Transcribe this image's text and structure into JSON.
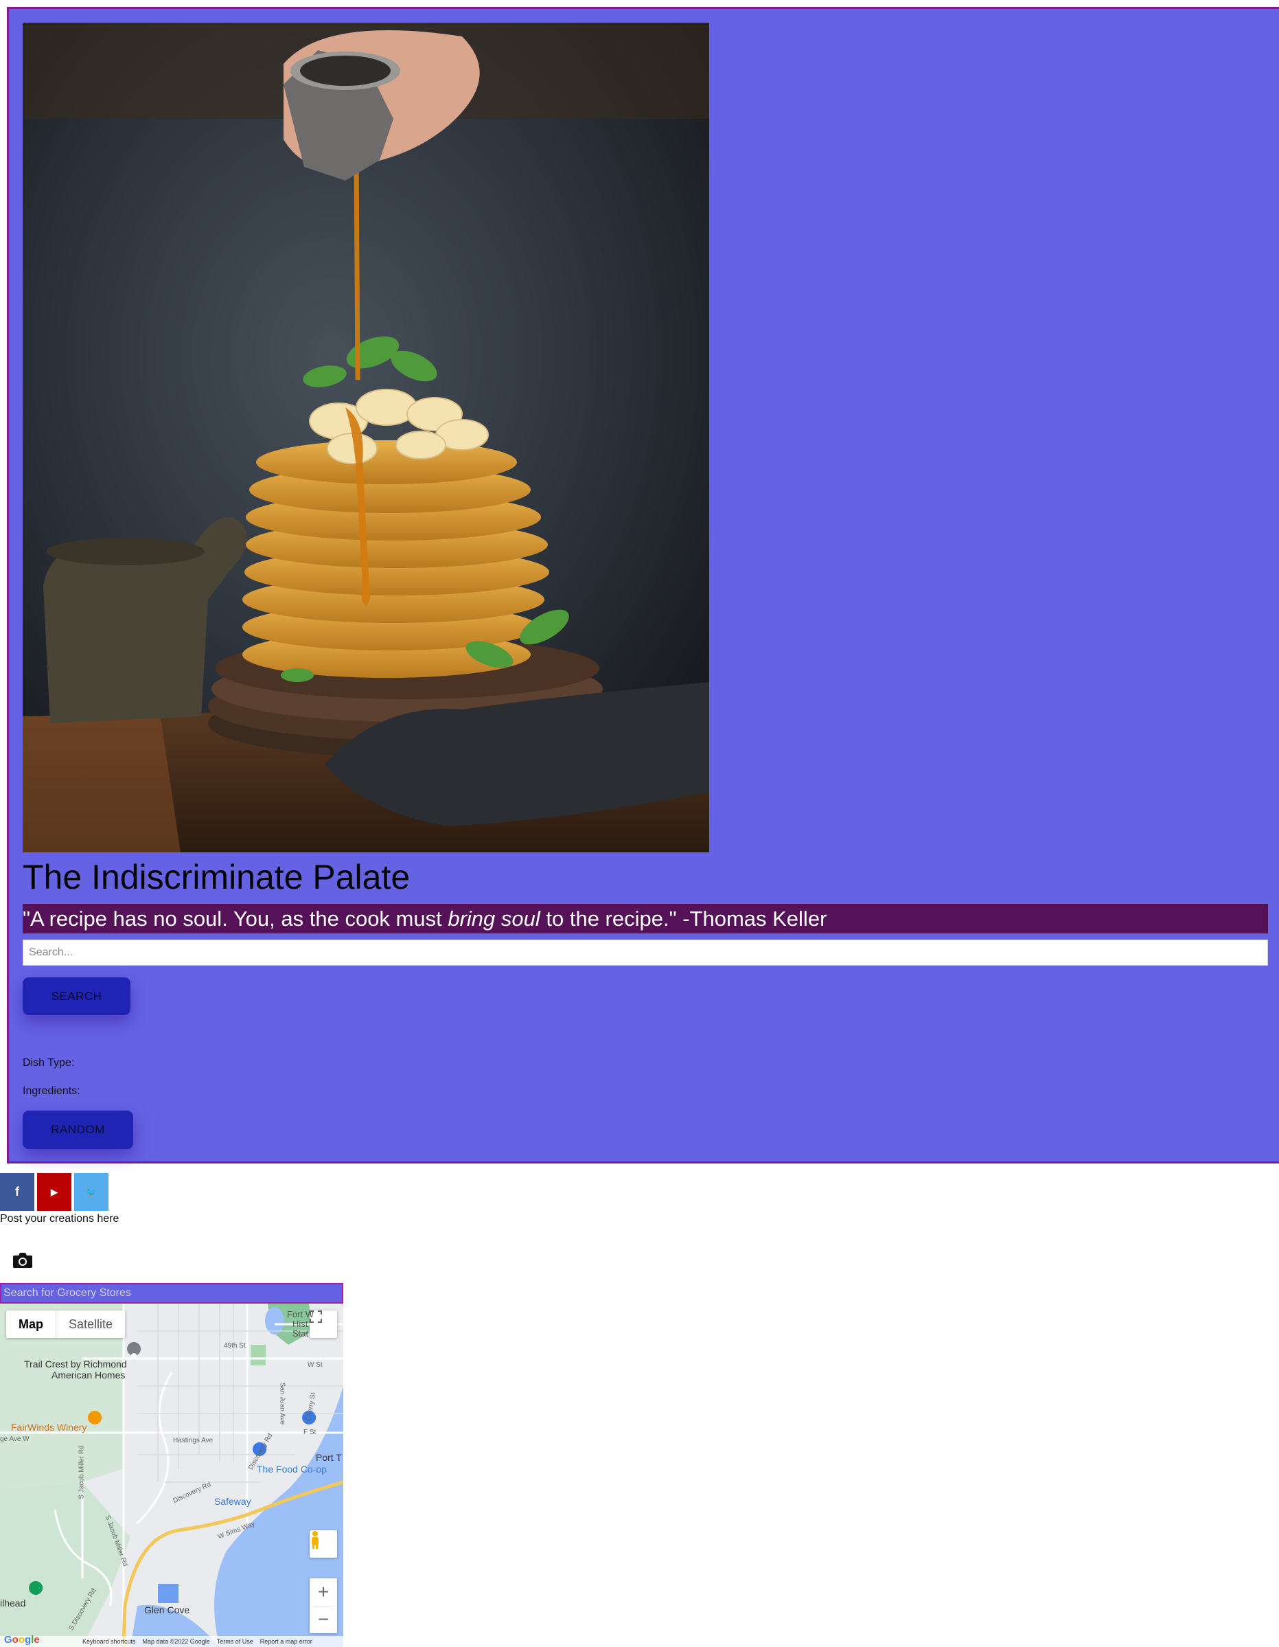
{
  "header": {
    "title": "The Indiscriminate Palate",
    "quote_before": "\"A recipe has no soul. You, as the cook must ",
    "quote_emphasis": "bring soul",
    "quote_after": " to the recipe.\" -Thomas Keller"
  },
  "search": {
    "placeholder": "Search...",
    "button_label": "SEARCH"
  },
  "filters": {
    "dish_type_label": "Dish Type:",
    "ingredients_label": "Ingredients:"
  },
  "random_button_label": "RANDOM",
  "social": {
    "facebook_glyph": "f",
    "youtube_glyph": "▶",
    "twitter_glyph": "🐦"
  },
  "post_text": "Post your creations here",
  "grocery_search": {
    "placeholder": "Search for Grocery Stores"
  },
  "map": {
    "type_options": [
      "Map",
      "Satellite"
    ],
    "selected_type": "Map",
    "labels": {
      "fort": "Fort W",
      "fort2": "Hist",
      "fort3": "Stat",
      "st49": "49th St",
      "trail_crest": "Trail Crest by Richmond",
      "american_homes": "American Homes",
      "fairwinds": "FairWinds Winery",
      "hastings": "Hastings Ave",
      "port": "Port T",
      "food_coop": "The Food Co-op",
      "safeway": "Safeway",
      "sims_way": "W Sims Way",
      "glen_cove": "Glen Cove",
      "trailhead": "ilhead",
      "discovery_rd": "Discovery Rd",
      "discovery_rd2": "Discovery Rd",
      "jacob_miller": "S Jacob Miller Rd",
      "jacob_miller2": "S Jacob Miller Rd",
      "san_juan": "San Juan Ave",
      "cherry": "Cherry St",
      "f_st": "F St",
      "w_st": "W St",
      "ave_w": "ge Ave W",
      "s_discovery": "S Discovery Rd"
    },
    "footer": {
      "google": "Google",
      "shortcuts": "Keyboard shortcuts",
      "data": "Map data ©2022 Google",
      "terms": "Terms of Use",
      "report": "Report a map error"
    },
    "zoom_in": "+",
    "zoom_out": "−"
  },
  "colors": {
    "hero_bg": "#6562e4",
    "quote_bar": "#561258",
    "button_bg": "#1f24b4",
    "facebook": "#3b5998",
    "youtube": "#bb0000",
    "twitter": "#55acee"
  }
}
